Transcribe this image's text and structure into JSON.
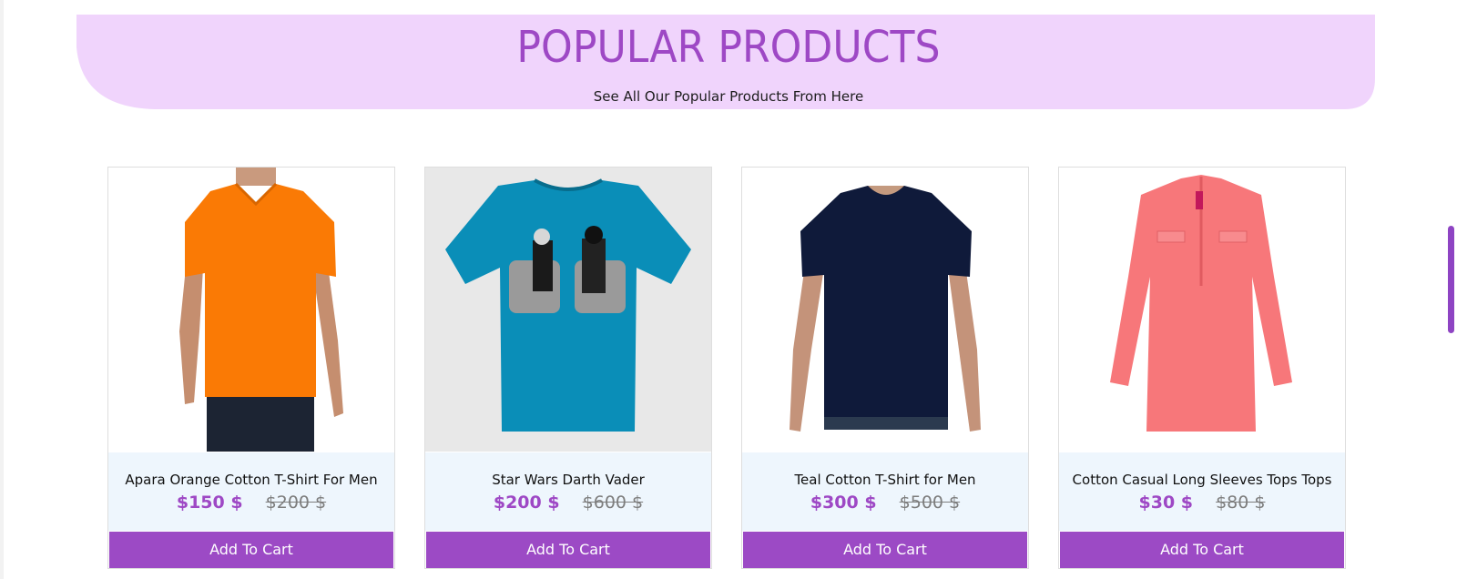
{
  "section": {
    "title": "POPULAR PRODUCTS",
    "subtitle": "See All Our Popular Products From Here"
  },
  "products": [
    {
      "name": "Apara Orange Cotton T-Shirt For Men",
      "price": "$150 $",
      "old_price": "$200 $",
      "button": "Add To Cart",
      "image": "orange-tshirt-man"
    },
    {
      "name": "Star Wars Darth Vader",
      "price": "$200 $",
      "old_price": "$600 $",
      "button": "Add To Cart",
      "image": "blue-star-wars-tshirt"
    },
    {
      "name": "Teal Cotton T-Shirt for Men",
      "price": "$300 $",
      "old_price": "$500 $",
      "button": "Add To Cart",
      "image": "navy-tshirt-man"
    },
    {
      "name": "Cotton Casual Long Sleeves Tops Tops",
      "price": "$30 $",
      "old_price": "$80 $",
      "button": "Add To Cart",
      "image": "coral-long-sleeve-top"
    }
  ],
  "colors": {
    "accent": "#9c4ac5",
    "banner": "#f0d4fc",
    "info_bg": "#eef6fd",
    "old_price": "#7d7d7d"
  }
}
